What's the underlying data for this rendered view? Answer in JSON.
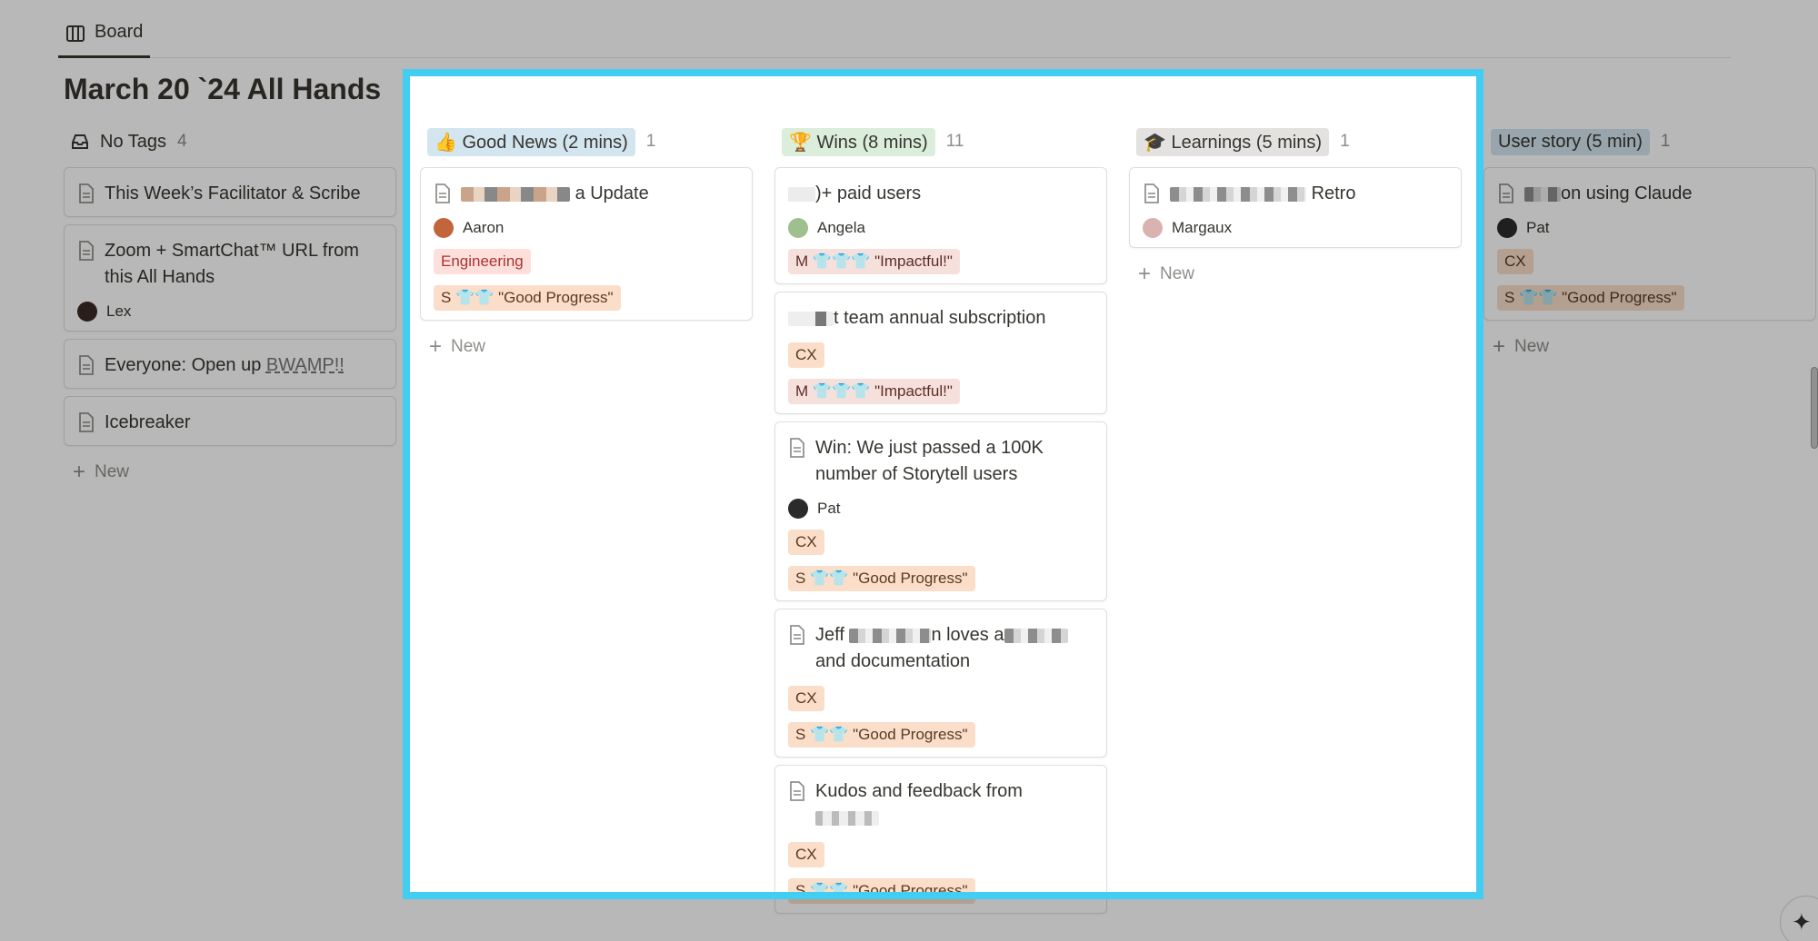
{
  "tab": {
    "label": "Board"
  },
  "page": {
    "title": "March 20 `24 All Hands"
  },
  "columns": [
    {
      "title": "No Tags",
      "count": "4",
      "cards": [
        {
          "title": "This Week’s Facilitator & Scribe"
        },
        {
          "title": "Zoom + SmartChat™ URL from this All Hands",
          "person": "Lex"
        },
        {
          "title_prefix": "Everyone: Open up ",
          "title_link": "BWAMP!!"
        },
        {
          "title": "Icebreaker"
        }
      ],
      "new_label": "New"
    },
    {
      "title": "Good News (2 mins)",
      "icon": "👍",
      "count": "1",
      "cards": [
        {
          "title": "a Update",
          "person": "Aaron",
          "tags": [
            "Engineering",
            "S 👕👕 \"Good Progress\""
          ]
        }
      ],
      "new_label": "New"
    },
    {
      "title": "Wins (8 mins)",
      "icon": "🏆",
      "count": "11",
      "cards": [
        {
          "title": ")+ paid users",
          "person": "Angela",
          "tags": [
            "M 👕👕👕 \"Impactful!\""
          ]
        },
        {
          "title": "t team annual subscription",
          "tags": [
            "CX",
            "M 👕👕👕 \"Impactful!\""
          ]
        },
        {
          "title": "Win: We just passed a 100K number of Storytell users",
          "person": "Pat",
          "tags": [
            "CX",
            "S 👕👕 \"Good Progress\""
          ]
        },
        {
          "title_a": "Jeff",
          "title_b": "n loves a",
          "title_c": "and documentation",
          "tags": [
            "CX",
            "S 👕👕 \"Good Progress\""
          ]
        },
        {
          "title": "Kudos and feedback from",
          "tags": [
            "CX",
            "S 👕👕 \"Good Progress\""
          ]
        }
      ]
    },
    {
      "title": "Learnings (5 mins)",
      "icon": "🎓",
      "count": "1",
      "cards": [
        {
          "title": "Retro",
          "person": "Margaux"
        }
      ],
      "new_label": "New"
    },
    {
      "title": "User story (5 min)",
      "count": "1",
      "cards": [
        {
          "title": "on using Claude",
          "person": "Pat",
          "tags": [
            "CX",
            "S 👕👕 \"Good Progress\""
          ]
        }
      ],
      "new_label": "New"
    }
  ],
  "colors": {
    "highlight_border": "#42cdf3",
    "good_news_bg": "#d3e5ef",
    "wins_bg": "#dbeddb",
    "learnings_bg": "#e3e2e0",
    "user_story_bg": "#d3e5ef"
  },
  "icons": [
    "board-icon",
    "inbox-icon",
    "page-icon",
    "plus-icon",
    "sparkle-icon"
  ]
}
